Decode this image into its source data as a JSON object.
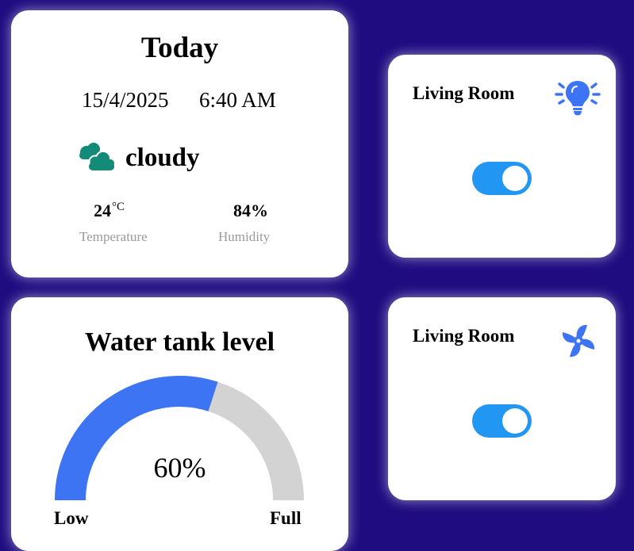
{
  "weather": {
    "title": "Today",
    "date": "15/4/2025",
    "time": "6:40 AM",
    "condition": "cloudy",
    "condition_icon": "cloud-icon",
    "temperature_value": "24",
    "temperature_unit": "°C",
    "temperature_label": "Temperature",
    "humidity_value": "84%",
    "humidity_label": "Humidity"
  },
  "tank": {
    "title": "Water tank level",
    "level_fraction": 0.6,
    "level_text": "60%",
    "low_label": "Low",
    "full_label": "Full"
  },
  "devices": [
    {
      "room": "Living Room",
      "icon": "lightbulb-icon",
      "on": true
    },
    {
      "room": "Living Room",
      "icon": "fan-icon",
      "on": true
    }
  ],
  "colors": {
    "background": "#1f0c80",
    "accent": "#2196f3",
    "gauge_fill": "#3d74f3",
    "gauge_track": "#d3d3d3",
    "weather_icon": "#148a78",
    "device_icon": "#3d74f3"
  }
}
